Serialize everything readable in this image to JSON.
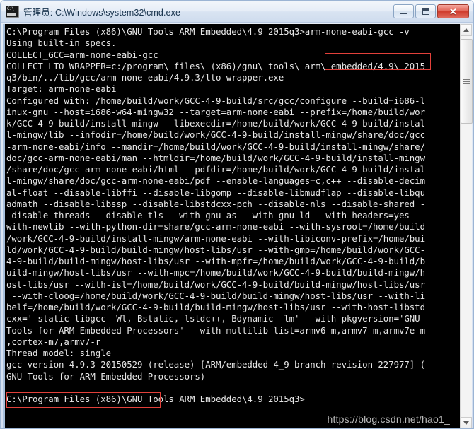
{
  "window": {
    "title": "管理员: C:\\Windows\\system32\\cmd.exe",
    "icon": "cmd-console-icon",
    "buttons": {
      "minimize_label": "–",
      "maximize_label": "□",
      "close_label": "✕"
    },
    "colors": {
      "titlebar_start": "#f2f6fb",
      "titlebar_end": "#cfdcee",
      "close_button": "#cf3b2c",
      "console_bg": "#000000",
      "console_fg": "#e6e6e6",
      "annotation_red": "#e2403a",
      "watermark_gray": "#b9b9b9"
    }
  },
  "console": {
    "lines": [
      "C:\\Program Files (x86)\\GNU Tools ARM Embedded\\4.9 2015q3>arm-none-eabi-gcc -v",
      "Using built-in specs.",
      "COLLECT_GCC=arm-none-eabi-gcc",
      "COLLECT_LTO_WRAPPER=c:/program\\ files\\ (x86)/gnu\\ tools\\ arm\\ embedded/4.9\\ 2015",
      "q3/bin/../lib/gcc/arm-none-eabi/4.9.3/lto-wrapper.exe",
      "Target: arm-none-eabi",
      "Configured with: /home/build/work/GCC-4-9-build/src/gcc/configure --build=i686-l",
      "inux-gnu --host=i686-w64-mingw32 --target=arm-none-eabi --prefix=/home/build/wor",
      "k/GCC-4-9-build/install-mingw --libexecdir=/home/build/work/GCC-4-9-build/instal",
      "l-mingw/lib --infodir=/home/build/work/GCC-4-9-build/install-mingw/share/doc/gcc",
      "-arm-none-eabi/info --mandir=/home/build/work/GCC-4-9-build/install-mingw/share/",
      "doc/gcc-arm-none-eabi/man --htmldir=/home/build/work/GCC-4-9-build/install-mingw",
      "/share/doc/gcc-arm-none-eabi/html --pdfdir=/home/build/work/GCC-4-9-build/instal",
      "l-mingw/share/doc/gcc-arm-none-eabi/pdf --enable-languages=c,c++ --disable-decim",
      "al-float --disable-libffi --disable-libgomp --disable-libmudflap --disable-libqu",
      "admath --disable-libssp --disable-libstdcxx-pch --disable-nls --disable-shared -",
      "-disable-threads --disable-tls --with-gnu-as --with-gnu-ld --with-headers=yes --",
      "with-newlib --with-python-dir=share/gcc-arm-none-eabi --with-sysroot=/home/build",
      "/work/GCC-4-9-build/install-mingw/arm-none-eabi --with-libiconv-prefix=/home/bui",
      "ld/work/GCC-4-9-build/build-mingw/host-libs/usr --with-gmp=/home/build/work/GCC-",
      "4-9-build/build-mingw/host-libs/usr --with-mpfr=/home/build/work/GCC-4-9-build/b",
      "uild-mingw/host-libs/usr --with-mpc=/home/build/work/GCC-4-9-build/build-mingw/h",
      "ost-libs/usr --with-isl=/home/build/work/GCC-4-9-build/build-mingw/host-libs/usr",
      " --with-cloog=/home/build/work/GCC-4-9-build/build-mingw/host-libs/usr --with-li",
      "belf=/home/build/work/GCC-4-9-build/build-mingw/host-libs/usr --with-host-libstd",
      "cxx='-static-libgcc -Wl,-Bstatic,-lstdc++,-Bdynamic -lm' --with-pkgversion='GNU",
      "Tools for ARM Embedded Processors' --with-multilib-list=armv6-m,armv7-m,armv7e-m",
      ",cortex-m7,armv7-r",
      "Thread model: single",
      "gcc version 4.9.3 20150529 (release) [ARM/embedded-4_9-branch revision 227977] (",
      "GNU Tools for ARM Embedded Processors)",
      "",
      "C:\\Program Files (x86)\\GNU Tools ARM Embedded\\4.9 2015q3>"
    ],
    "watermark": "https://blog.csdn.net/hao1_"
  },
  "annotations": [
    {
      "name": "command-highlight",
      "text": "arm-none-eabi-gcc -v"
    },
    {
      "name": "version-highlight",
      "text": "gcc version 4.9.3 20150529"
    }
  ],
  "scrollbar": {
    "up_arrow": "scroll-up-arrow-icon",
    "down_arrow": "scroll-down-arrow-icon",
    "thumb": "scrollbar-thumb"
  }
}
